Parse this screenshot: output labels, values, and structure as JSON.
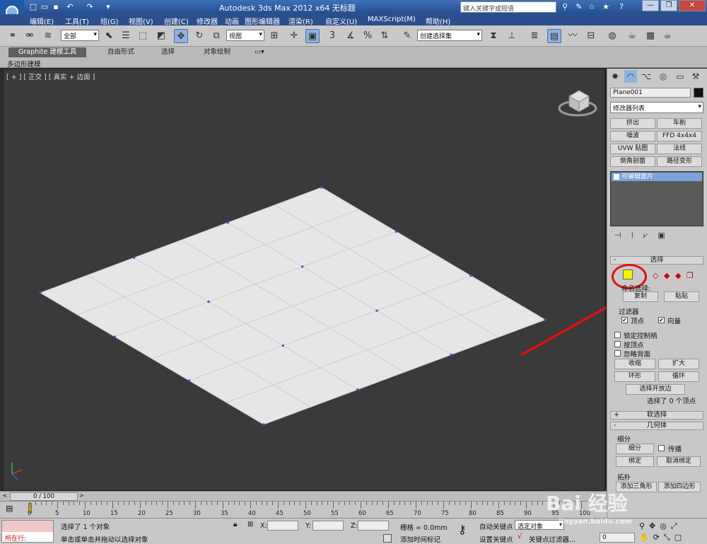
{
  "window": {
    "title": "Autodesk 3ds Max  2012 x64     无标题",
    "search_placeholder": "键入关键字或短语"
  },
  "menu": [
    "编辑(E)",
    "工具(T)",
    "组(G)",
    "视图(V)",
    "创建(C)",
    "修改器",
    "动画",
    "图形编辑器",
    "渲染(R)",
    "自定义(U)",
    "MAXScript(M)",
    "帮助(H)"
  ],
  "toolbar": {
    "selection_filter": "全部",
    "ref_coord": "视图",
    "named_selection": "创建选择集",
    "spinner_label": "3"
  },
  "ribbon": {
    "tabs": [
      "Graphite 建模工具",
      "自由形式",
      "选择",
      "对象绘制"
    ],
    "subtab": "多边形建模"
  },
  "viewport": {
    "label": "[ + ] [ 正交 ] [ 真实 + 边面 ]",
    "grid_rows": 6,
    "grid_cols": 6
  },
  "command_panel": {
    "object_name": "Plane001",
    "modifier_list": "修改器列表",
    "modifier_buttons": [
      "挤出",
      "车削",
      "噪波",
      "FFD 4x4x4",
      "UVW 贴图",
      "法线",
      "倒角剖面",
      "路径变形"
    ],
    "stack_item": "可编辑面片",
    "rollout_selection": "选择",
    "named_selection_label": "命名选择:",
    "copy": "复制",
    "paste": "粘贴",
    "filter_label": "过滤器",
    "filter_vertex": "顶点",
    "filter_vector": "向量",
    "lock_handles": "锁定控制柄",
    "by_vertex": "按顶点",
    "ignore_backfacing": "忽略背面",
    "shrink": "收缩",
    "grow": "扩大",
    "ring": "环形",
    "loop": "循环",
    "select_open_edges": "选择开放边",
    "selection_info": "选择了 0 个顶点",
    "rollout_soft": "软选择",
    "rollout_geometry": "几何体",
    "subdivide_label": "细分",
    "subdivide_btn": "细分",
    "propagate": "传播",
    "bind": "绑定",
    "unbind": "取消绑定",
    "topology_label": "拓扑",
    "add_tri": "添加三角形",
    "add_quad": "添加四边形"
  },
  "timeline": {
    "slider": "0 / 100",
    "ticks": [
      "0",
      "5",
      "10",
      "15",
      "20",
      "25",
      "30",
      "35",
      "40",
      "45",
      "50",
      "55",
      "60",
      "65",
      "70",
      "75",
      "80",
      "85",
      "90",
      "95",
      "100"
    ]
  },
  "status": {
    "maxscript_label": "所在行:",
    "selected": "选择了 1 个对象",
    "prompt": "单击或单击并拖动以选择对象",
    "x_label": "X:",
    "y_label": "Y:",
    "z_label": "Z:",
    "grid": "栅格 = 0.0mm",
    "add_time_tag": "添加时间标记",
    "auto_key": "自动关键点",
    "set_key": "设置关键点",
    "selected_dropdown": "选定对象",
    "key_filters": "关键点过滤器...",
    "frame": "0"
  },
  "watermark": {
    "brand": "Bai 经验",
    "url": "jingyan.baidu.com"
  },
  "colors": {
    "viewport_bg": "#3a3a3a",
    "plane": "#e6e6e6",
    "vertex": "#4b4bd6",
    "annotation": "#e01010",
    "highlight": "#f5f500"
  }
}
